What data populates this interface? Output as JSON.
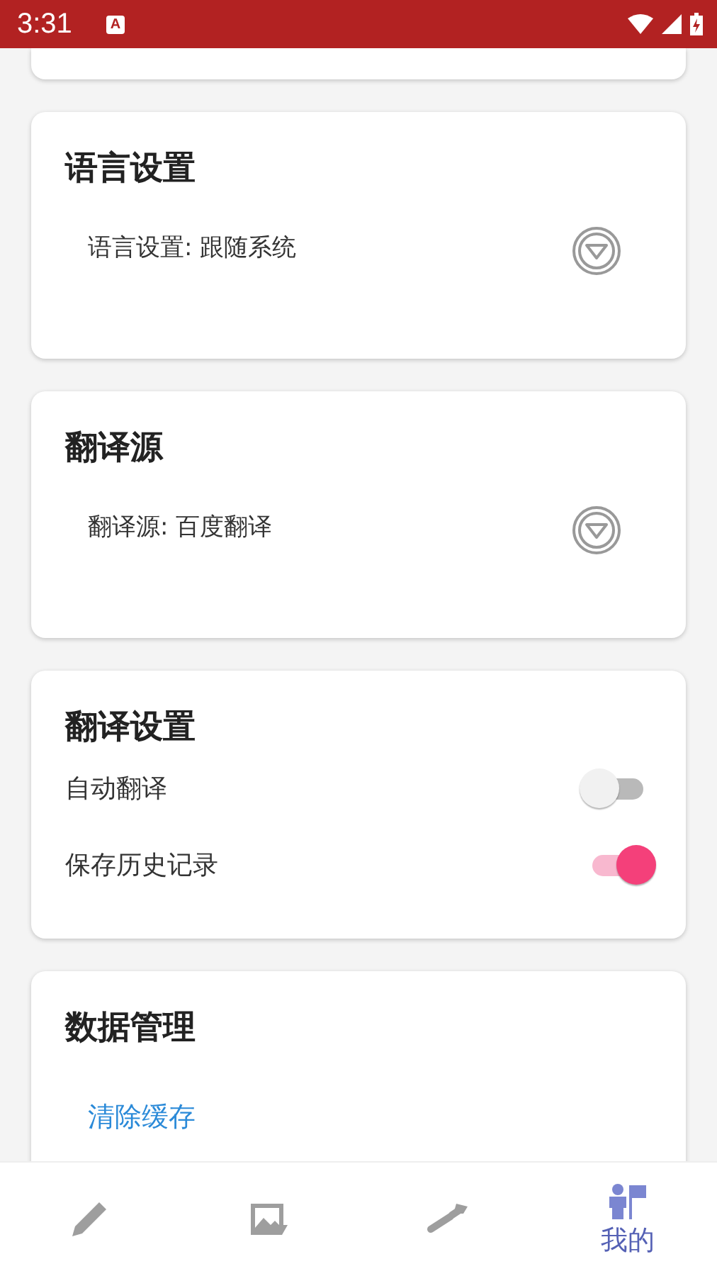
{
  "status_bar": {
    "time": "3:31",
    "notification": "A"
  },
  "sections": [
    {
      "kind": "blank"
    },
    {
      "kind": "dropdown",
      "title": "语言设置",
      "value": "语言设置: 跟随系统"
    },
    {
      "kind": "dropdown",
      "title": "翻译源",
      "value": "翻译源: 百度翻译"
    },
    {
      "kind": "toggles",
      "title": "翻译设置",
      "items": [
        {
          "label": "自动翻译",
          "on": false
        },
        {
          "label": "保存历史记录",
          "on": true
        }
      ]
    },
    {
      "kind": "actions",
      "title": "数据管理",
      "items": [
        "清除缓存"
      ]
    }
  ],
  "bottom_nav": [
    {
      "kind": "pencil",
      "selected": false
    },
    {
      "kind": "image",
      "selected": false
    },
    {
      "kind": "wrench",
      "selected": false
    },
    {
      "kind": "person",
      "label": "我的",
      "selected": true
    }
  ]
}
